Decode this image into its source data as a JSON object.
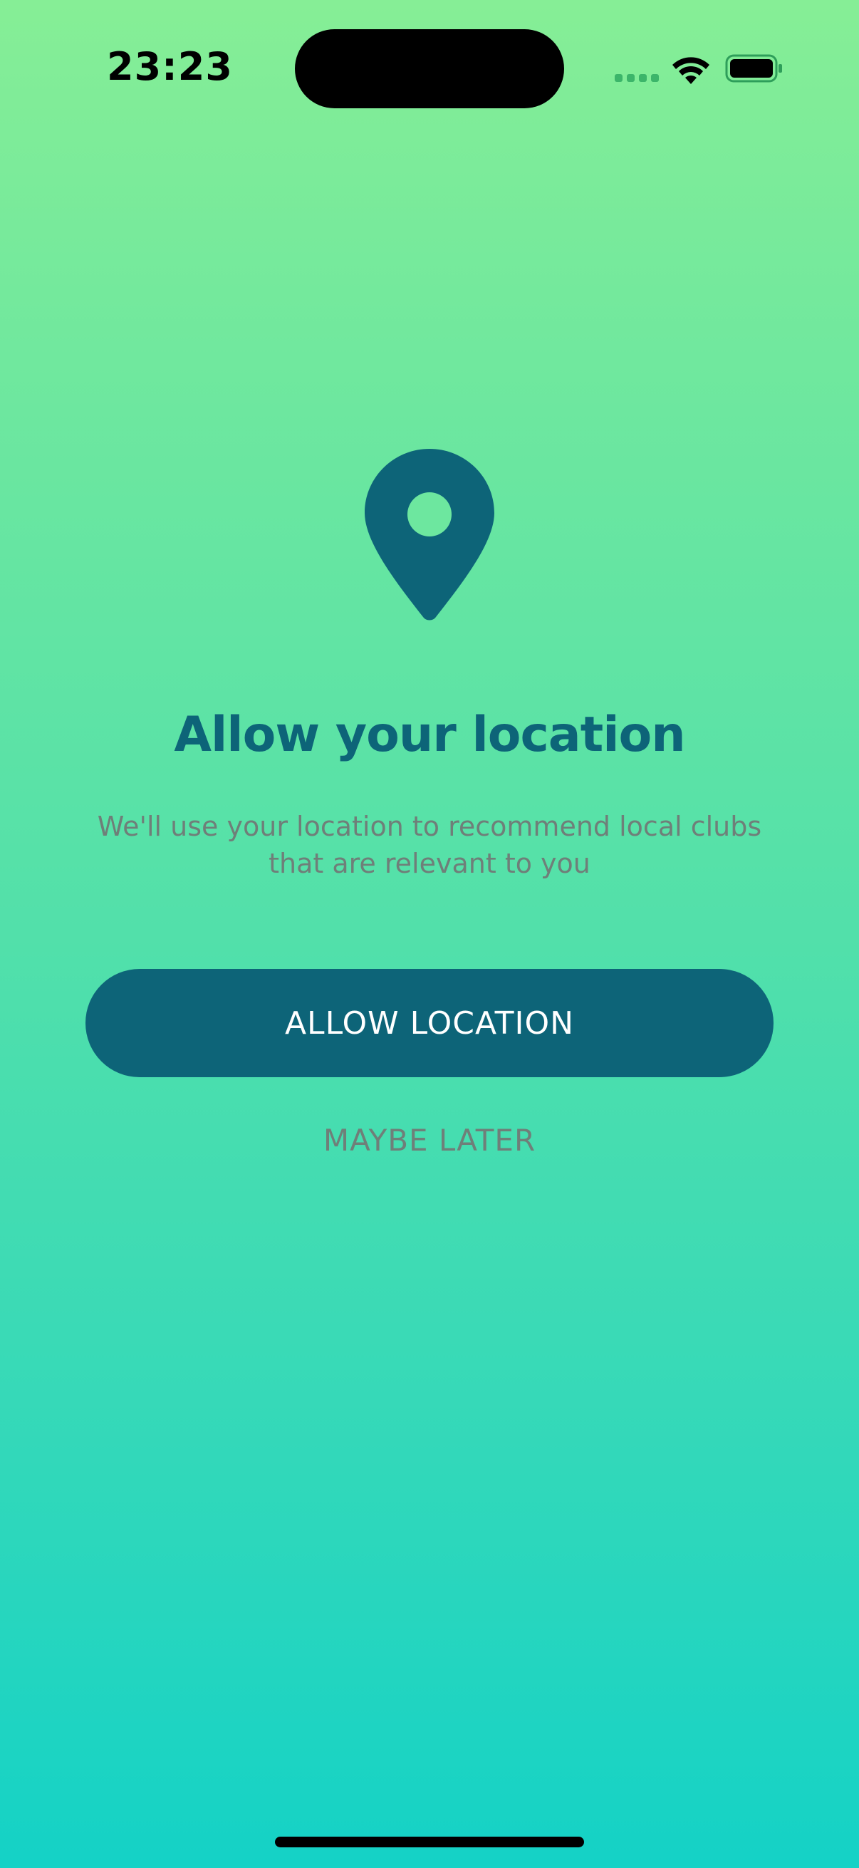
{
  "status_bar": {
    "time": "23:23"
  },
  "icons": {
    "pin": "location-pin-icon",
    "wifi": "wifi-icon",
    "battery": "battery-icon",
    "signal": "cellular-signal-icon"
  },
  "content": {
    "title": "Allow your location",
    "subtitle": "We'll use your location to recommend local clubs that are relevant to you"
  },
  "actions": {
    "allow_label": "ALLOW LOCATION",
    "later_label": "MAYBE LATER"
  },
  "colors": {
    "primary": "#0d6478",
    "muted_text": "#6f7f79",
    "gradient_top": "#86ee96",
    "gradient_bottom": "#14d2c6"
  }
}
